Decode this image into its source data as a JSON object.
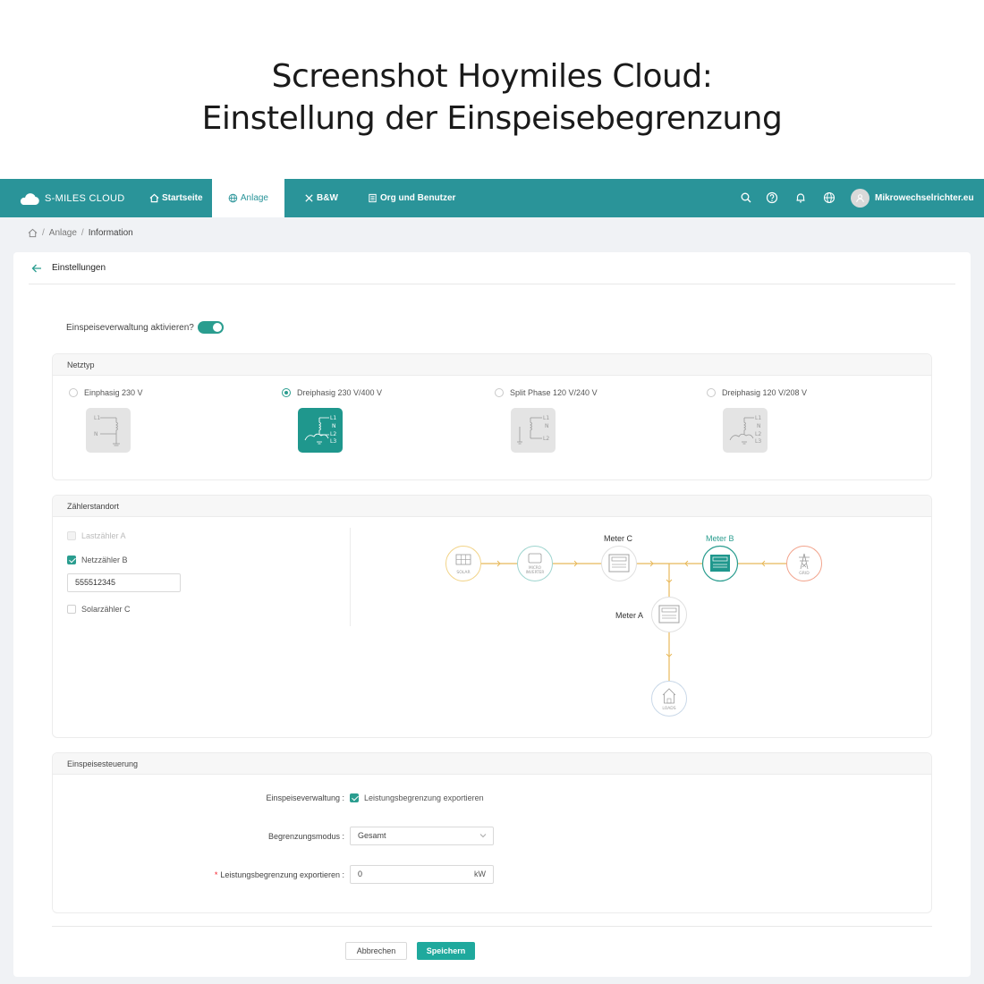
{
  "caption": {
    "line1": "Screenshot Hoymiles Cloud:",
    "line2": "Einstellung der Einspeisebegrenzung"
  },
  "topbar": {
    "brand": "S-MILES CLOUD",
    "nav": [
      {
        "label": "Startseite",
        "icon": "home-icon"
      },
      {
        "label": "Anlage",
        "icon": "globe-icon",
        "active": true
      },
      {
        "label": "B&W",
        "icon": "tools-icon"
      },
      {
        "label": "Org und Benutzer",
        "icon": "document-icon"
      }
    ],
    "user_name": "Mikrowechselrichter.eu",
    "accent": "#2a9499"
  },
  "breadcrumb": [
    "Anlage",
    "Information"
  ],
  "card": {
    "title": "Einstellungen",
    "toggle_label": "Einspeiseverwaltung aktivieren?",
    "toggle_on": true
  },
  "netztyp": {
    "title": "Netztyp",
    "options": [
      {
        "label": "Einphasig 230 V",
        "selected": false,
        "lines": [
          "L1",
          "N"
        ]
      },
      {
        "label": "Dreiphasig 230 V/400 V",
        "selected": true,
        "lines": [
          "L1",
          "N",
          "L2",
          "L3"
        ]
      },
      {
        "label": "Split Phase 120 V/240 V",
        "selected": false,
        "lines": [
          "L1",
          "N",
          "L2"
        ]
      },
      {
        "label": "Dreiphasig 120 V/208 V",
        "selected": false,
        "lines": [
          "L1",
          "N",
          "L2",
          "L3"
        ]
      }
    ]
  },
  "zaehler": {
    "title": "Zählerstandort",
    "meters": [
      {
        "label": "Lastzähler A",
        "checked": false,
        "disabled": true
      },
      {
        "label": "Netzzähler B",
        "checked": true,
        "disabled": false
      },
      {
        "label": "Solarzähler C",
        "checked": false,
        "disabled": false
      }
    ],
    "serial": "555512345",
    "diagram": {
      "solar": "SOLAR",
      "micro_line1": "MICRO",
      "micro_line2": "INVERTER",
      "grid": "GRID",
      "loads": "LOADS",
      "meter_c": "Meter C",
      "meter_b": "Meter B",
      "meter_a": "Meter A"
    }
  },
  "steuerung": {
    "title": "Einspeisesteuerung",
    "mgmt_label": "Einspeiseverwaltung :",
    "mgmt_option": "Leistungsbegrenzung exportieren",
    "mode_label": "Begrenzungsmodus :",
    "mode_value": "Gesamt",
    "limit_required": "*",
    "limit_label": "Leistungsbegrenzung exportieren :",
    "limit_value": "0",
    "limit_unit": "kW"
  },
  "buttons": {
    "cancel": "Abbrechen",
    "save": "Speichern"
  }
}
